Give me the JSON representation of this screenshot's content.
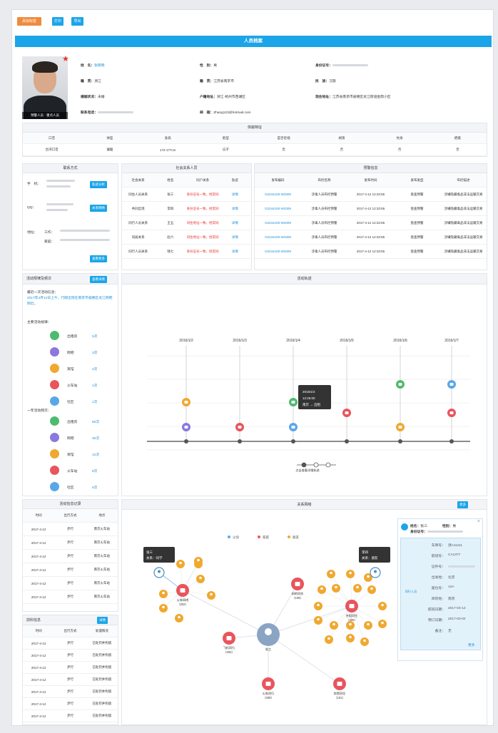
{
  "toolbar": {
    "btn1": "添加标签",
    "btn2": "打印",
    "btn3": "导出",
    "colors": [
      "#f08a3e",
      "#1ba5e8",
      "#1ba5e8"
    ]
  },
  "header": {
    "title": "人员档案"
  },
  "profile": {
    "photo_caption": "预警人员 · 重点人员",
    "star": "★",
    "fields": [
      {
        "label": "姓　名：",
        "value": "张晓晓",
        "blue": true
      },
      {
        "label": "性　别：",
        "value": "男"
      },
      {
        "label": "身份证号：",
        "value": ""
      },
      {
        "label": "籍　贯：",
        "value": "浙江"
      },
      {
        "label": "籍　贯：",
        "value": "江苏省南京市"
      },
      {
        "label": "民　族：",
        "value": "汉族"
      },
      {
        "label": "婚姻状况：",
        "value": "未婚"
      },
      {
        "label": "户籍地址：",
        "value": "浙江·杭州市西湖区"
      },
      {
        "label": "现住地址：",
        "value": "江苏省南京市鼓楼区龙江街道金鼎小区"
      },
      {
        "label": "联系电话：",
        "value": ""
      },
      {
        "label": "邮　箱：",
        "value": "Zhang123@hotmail.com"
      }
    ]
  },
  "features": {
    "title": "体貌特征",
    "headers": [
      "口音",
      "体型",
      "身高",
      "脸型",
      "是否近视",
      "胡须",
      "纹身",
      "疤痕"
    ],
    "values": [
      "台湾口音",
      "偏瘦",
      "172-177cm",
      "瓜子",
      "否",
      "否",
      "否",
      "否"
    ]
  },
  "contact": {
    "title": "联系方式",
    "phone_label": "手　机：",
    "phone_btn": "轨迹分析",
    "qq_label": "QQ：",
    "qq_btn": "关系网络",
    "addr_label": "地址：",
    "addr_sub1": "工作：",
    "addr_sub2": "家庭：",
    "more_btn": "查看更多"
  },
  "relations": {
    "title": "社会关系人员",
    "headers": [
      "社会关系",
      "姓名",
      "同户关系",
      "轨迹"
    ],
    "rows": [
      [
        "同住人员关系",
        "张三",
        "身份证号一致，经常同一地",
        "详情"
      ],
      [
        "共同出现",
        "李四",
        "身份证号一致，经常同一地",
        "详情"
      ],
      [
        "同行人员关系",
        "王五",
        "同住地址一致，经常同一地",
        "详情"
      ],
      [
        "同居关系",
        "赵六",
        "同住地址一致，经常同一地",
        "详情"
      ],
      [
        "同行人员关系",
        "钱七",
        "身份证号一致，经常同一地",
        "详情"
      ]
    ]
  },
  "alerts": {
    "title": "预警信息",
    "headers": [
      "发布编码",
      "布控名称",
      "发布时间",
      "发布类型",
      "布控描述"
    ],
    "rows": [
      [
        "G2244100-W3309",
        "涉毒人员布控预警",
        "2017-4-12 12:33:55",
        "盘查预警",
        "涉嫌隐藏毒品非法运输交易"
      ],
      [
        "G2244100-W3309",
        "涉毒人员布控预警",
        "2017-4-12 12:33:55",
        "盘查预警",
        "涉嫌隐藏毒品非法运输交易"
      ],
      [
        "G2244100-W3309",
        "涉毒人员布控预警",
        "2017-4-12 12:33:55",
        "盘查预警",
        "涉嫌隐藏毒品非法运输交易"
      ],
      [
        "G2244100-W3309",
        "涉毒人员布控预警",
        "2017-4-12 12:33:55",
        "盘查预警",
        "涉嫌隐藏毒品非法运输交易"
      ],
      [
        "G2244100-W3309",
        "涉毒人员布控预警",
        "2017-4-12 12:33:55",
        "盘查预警",
        "涉嫌隐藏毒品非法运输交易"
      ]
    ]
  },
  "activity": {
    "title": "活动规律及频次",
    "btn": "查看详情",
    "hint_title": "最近一次活动信息：",
    "hint_text": "2017年4月12日上午，行踪出现在南京市鼓楼区龙江网吧附近。",
    "top_title": "主要活动规律：",
    "top_items": [
      {
        "name": "出租房",
        "count": "5次",
        "color": "#4fba6f"
      },
      {
        "name": "网吧",
        "count": "3次",
        "color": "#8a78dd"
      },
      {
        "name": "宾馆",
        "count": "2次",
        "color": "#f0a830"
      },
      {
        "name": "火车站",
        "count": "1次",
        "color": "#e8555d"
      },
      {
        "name": "社区",
        "count": "1次",
        "color": "#5aa7e8"
      }
    ],
    "bottom_title": "一年活动频次：",
    "bottom_items": [
      {
        "name": "出租房",
        "count": "50次",
        "color": "#4fba6f"
      },
      {
        "name": "网吧",
        "count": "30次",
        "color": "#8a78dd"
      },
      {
        "name": "宾馆",
        "count": "12次",
        "color": "#f0a830"
      },
      {
        "name": "火车站",
        "count": "8次",
        "color": "#e8555d"
      },
      {
        "name": "社区",
        "count": "5次",
        "color": "#5aa7e8"
      }
    ]
  },
  "timeline": {
    "title": "活动轨迹",
    "dates": [
      "2016/1/2",
      "2016/1/3",
      "2016/1/4",
      "2016/1/5",
      "2016/1/6",
      "2016/1/7"
    ],
    "tooltip": {
      "line1": "2016/1/4",
      "line2": "12:25:00",
      "line3": "南京 → 出租"
    },
    "legend": "点击查看详细轨迹"
  },
  "jobs": {
    "title": "活动信息记录",
    "headers": [
      "时间",
      "出行方式",
      "地点"
    ],
    "rows": [
      [
        "2017-4-12",
        "步行",
        "南京火车站"
      ],
      [
        "2017-4-12",
        "步行",
        "南京火车站"
      ],
      [
        "2017-4-12",
        "步行",
        "南京火车站"
      ],
      [
        "2017-4-12",
        "步行",
        "南京火车站"
      ],
      [
        "2017-4-12",
        "步行",
        "南京火车站"
      ],
      [
        "2017-4-12",
        "步行",
        "南京火车站"
      ]
    ]
  },
  "records": {
    "title": "前科信息",
    "btn": "详情",
    "headers": [
      "时间",
      "出行方式",
      "处理情况"
    ],
    "rows": [
      [
        "2017-4-12",
        "步行",
        "已处罚并拘留"
      ],
      [
        "2017-4-12",
        "步行",
        "已处罚并拘留"
      ],
      [
        "2017-4-12",
        "步行",
        "已处罚并拘留"
      ],
      [
        "2017-4-12",
        "步行",
        "已处罚并拘留"
      ],
      [
        "2017-4-12",
        "步行",
        "已处罚并拘留"
      ],
      [
        "2017-4-12",
        "步行",
        "已处罚并拘留"
      ],
      [
        "2017-4-12",
        "步行",
        "已处罚并拘留"
      ]
    ]
  },
  "graph": {
    "title": "关系网络",
    "btn": "更多",
    "legend": [
      "父母",
      "家庭",
      "朋友"
    ],
    "tip_left": {
      "line1": "张三",
      "line2": "关系：同学"
    },
    "tip_right": {
      "line1": "李四",
      "line2": "关系：朋友"
    },
    "center_label": "张三",
    "labels": [
      {
        "t1": "火车网吧",
        "t2": "（202）"
      },
      {
        "t1": "网吧同伴",
        "t2": "（108）"
      },
      {
        "t1": "合租同住",
        "t2": "（205）"
      },
      {
        "t1": "飞机同行",
        "t2": "（202）"
      },
      {
        "t1": "火车同行",
        "t2": "（208）"
      },
      {
        "t1": "宾馆同住",
        "t2": "（101）"
      }
    ]
  },
  "detail": {
    "close": "×",
    "name_label": "姓名：",
    "name_value": "张三",
    "gender_label": "性别：",
    "gender_value": "男",
    "id_label": "身份证号：",
    "side_label": "同行人员",
    "rows": [
      {
        "k": "车牌号：",
        "v": "浙A11111"
      },
      {
        "k": "航班号：",
        "v": "CA1377"
      },
      {
        "k": "证件号：",
        "v": ""
      },
      {
        "k": "出发地：",
        "v": "北京"
      },
      {
        "k": "座位号：",
        "v": "12A"
      },
      {
        "k": "目的地：",
        "v": "南京"
      },
      {
        "k": "航班日期：",
        "v": "2017-03-12"
      },
      {
        "k": "预订日期：",
        "v": "2017-03-02"
      },
      {
        "k": "备注：",
        "v": "无"
      }
    ],
    "more": "更多"
  }
}
